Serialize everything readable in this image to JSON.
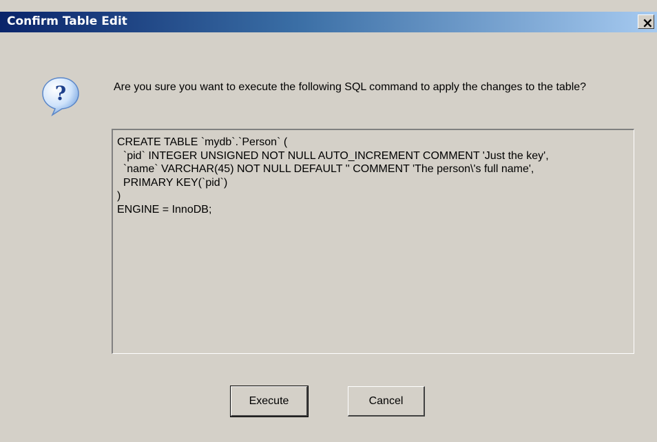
{
  "dialog": {
    "title": "Confirm Table Edit",
    "close_label": "×",
    "icon": "question-icon",
    "message": "Are you sure you want to execute the following SQL command to apply the changes to the table?",
    "sql": "CREATE TABLE `mydb`.`Person` (\n  `pid` INTEGER UNSIGNED NOT NULL AUTO_INCREMENT COMMENT 'Just the key',\n  `name` VARCHAR(45) NOT NULL DEFAULT '' COMMENT 'The person\\'s full name',\n  PRIMARY KEY(`pid`)\n)\nENGINE = InnoDB;",
    "buttons": {
      "execute": "Execute",
      "cancel": "Cancel"
    }
  },
  "colors": {
    "titlebar_start": "#0a246a",
    "titlebar_end": "#a6caf0",
    "window_bg": "#d4d0c8"
  }
}
